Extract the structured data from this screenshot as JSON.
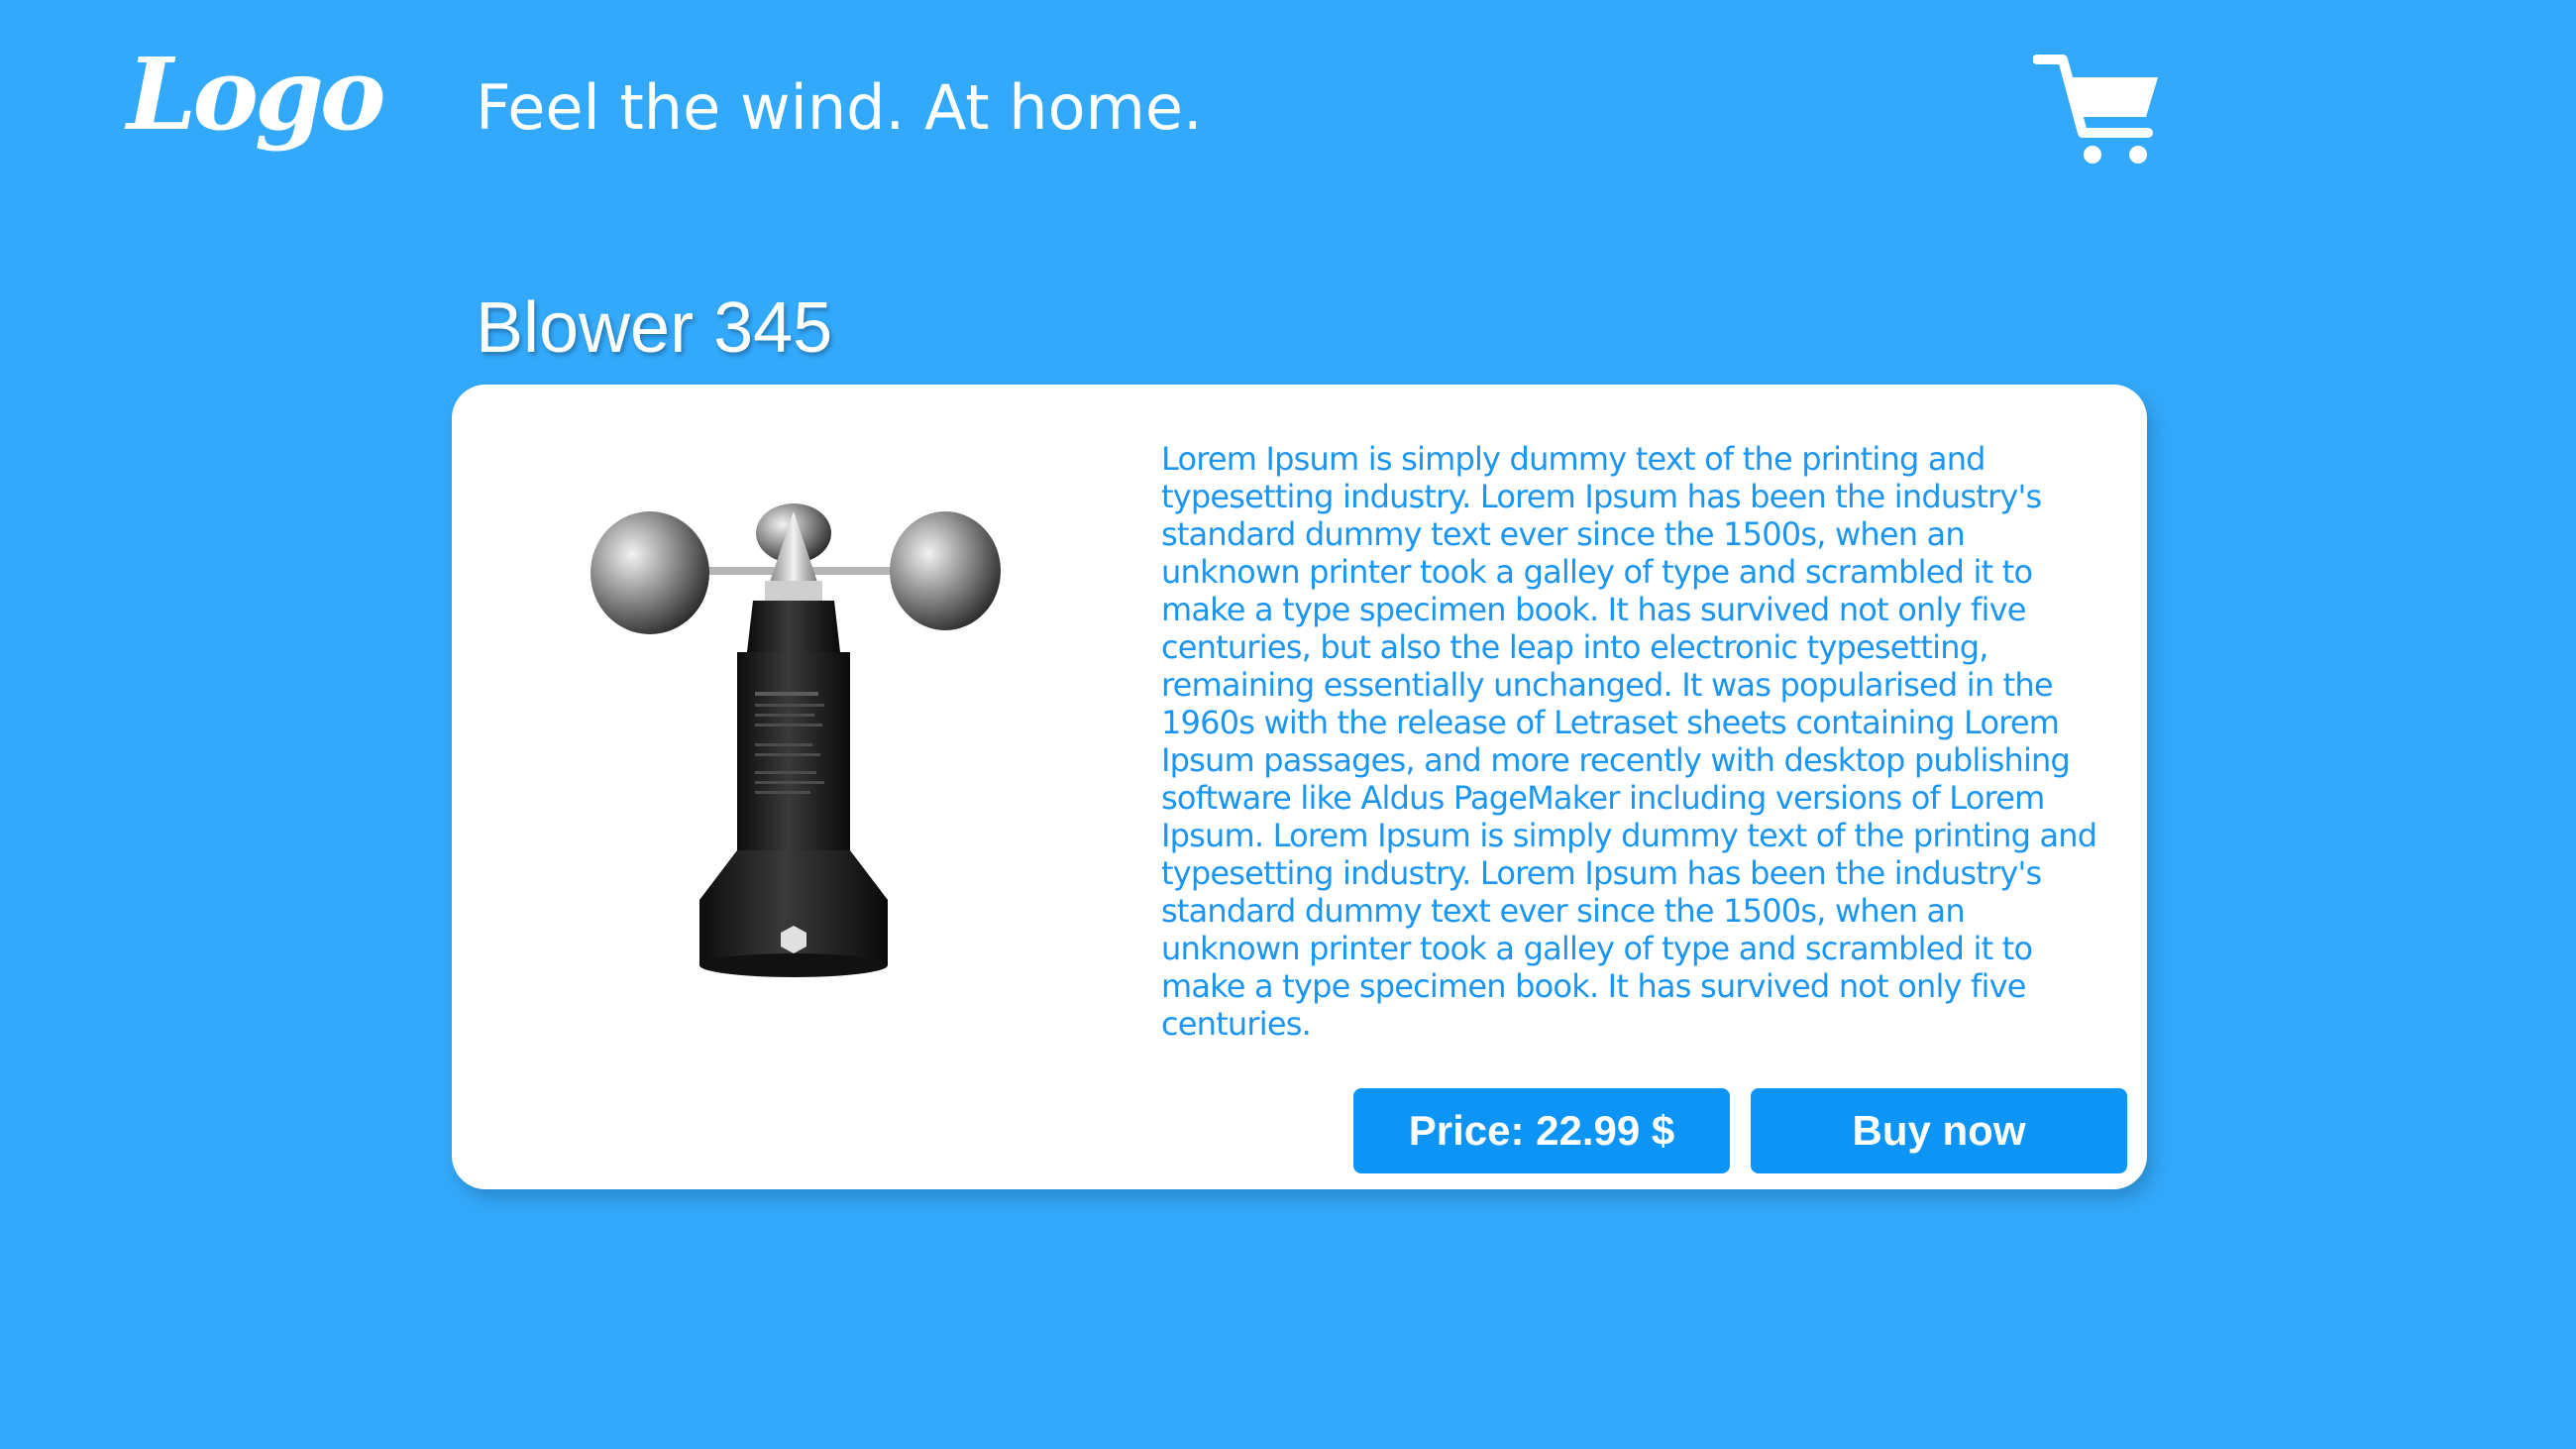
{
  "header": {
    "logo_text": "Logo",
    "tagline": "Feel the wind. At home.",
    "cart_icon": "shopping-cart-icon"
  },
  "product": {
    "name": "Blower 345",
    "image_icon": "anemometer-image",
    "description": "Lorem Ipsum is simply dummy text of the printing and typesetting industry. Lorem Ipsum has been the industry's standard dummy text ever since the 1500s, when an unknown printer took a galley of type and scrambled it to make a type specimen book. It has survived not only five centuries, but also the leap into electronic typesetting, remaining essentially unchanged. It was popularised in the 1960s with the release of Letraset sheets containing Lorem Ipsum passages, and more recently with desktop publishing software like Aldus PageMaker including versions of Lorem Ipsum. Lorem Ipsum is simply dummy text of the printing and typesetting industry. Lorem Ipsum has been the industry's standard dummy text ever since the 1500s, when an unknown printer took a galley of type and scrambled it to make a type specimen book. It has survived not only five centuries.",
    "price_label": "Price: 22.99 $",
    "buy_label": "Buy now"
  },
  "colors": {
    "background": "#33a9fc",
    "card": "#ffffff",
    "accent": "#0c94f6",
    "description_text": "#1a96f2"
  }
}
